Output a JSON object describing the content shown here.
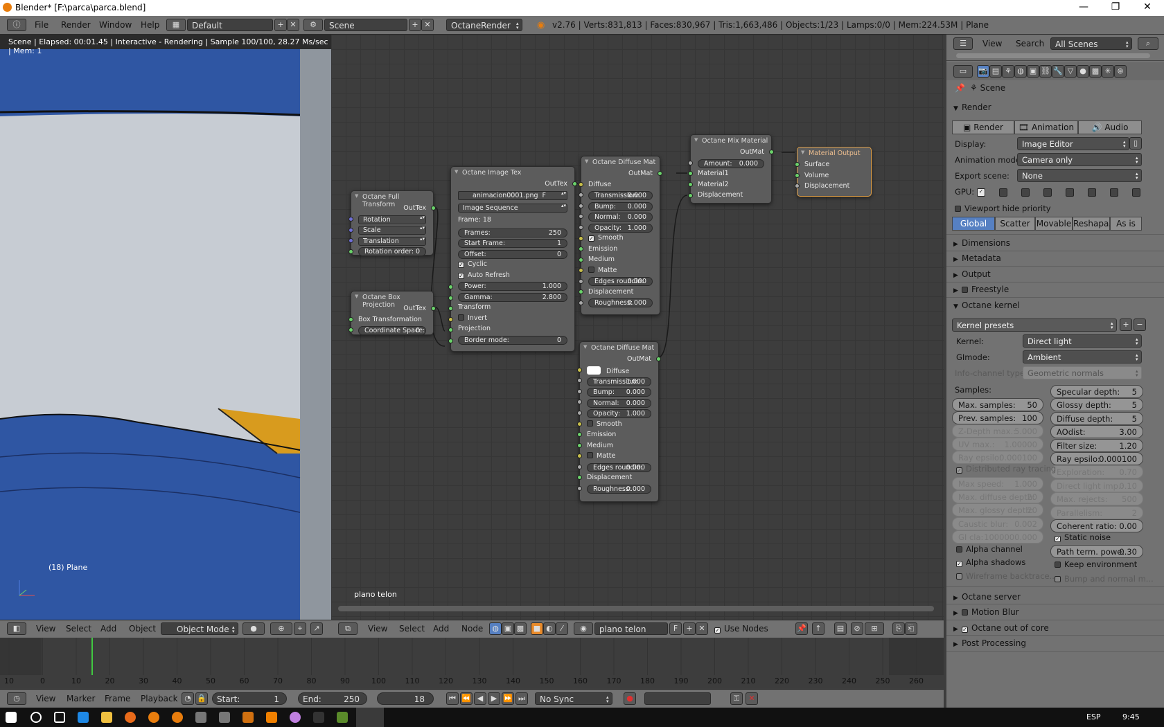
{
  "window": {
    "title": "Blender* [F:\\parca\\parca.blend]",
    "minimize": "—",
    "maximize": "❐",
    "close": "✕"
  },
  "topmenu": {
    "file": "File",
    "render": "Render",
    "window": "Window",
    "help": "Help",
    "layout": "Default",
    "scene": "Scene",
    "engine": "OctaneRender"
  },
  "stats": "v2.76 | Verts:831,813 | Faces:830,967 | Tris:1,663,486 | Objects:1/23 | Lamps:0/0 | Mem:224.53M | Plane",
  "viewport": {
    "status": "Scene | Elapsed: 00:01.45 | Interactive - Rendering | Sample 100/100, 28.27 Ms/sec | Mem: 1",
    "object_label": "(18) Plane",
    "axes": {
      "x": "x",
      "y": "y",
      "z": "z"
    }
  },
  "viewport_header": {
    "view": "View",
    "select": "Select",
    "add": "Add",
    "object": "Object",
    "mode": "Object Mode"
  },
  "nodes": {
    "full_transform": {
      "title": "Octane Full Transform",
      "out": "OutTex",
      "rotation": "Rotation",
      "scale": "Scale",
      "translation": "Translation",
      "rotation_order_label": "Rotation order:",
      "rotation_order": "0"
    },
    "box_projection": {
      "title": "Octane Box Projection",
      "out": "OutTex",
      "box_transform": "Box Transformation",
      "coord_label": "Coordinate Space:",
      "coord": "0"
    },
    "image_tex": {
      "title": "Octane Image Tex",
      "out": "OutTex",
      "file": "animacion0001.png",
      "f": "F",
      "source": "Image Sequence",
      "frame": "Frame: 18",
      "frames_label": "Frames:",
      "frames": "250",
      "start_label": "Start Frame:",
      "start": "1",
      "offset_label": "Offset:",
      "offset": "0",
      "cyclic": "Cyclic",
      "auto_refresh": "Auto Refresh",
      "power_label": "Power:",
      "power": "1.000",
      "gamma_label": "Gamma:",
      "gamma": "2.800",
      "transform": "Transform",
      "invert": "Invert",
      "projection": "Projection",
      "border_label": "Border mode:",
      "border": "0"
    },
    "diffuse1": {
      "title": "Octane Diffuse Mat",
      "out": "OutMat",
      "diffuse": "Diffuse",
      "transmission_label": "Transmission:",
      "transmission": "0.000",
      "bump_label": "Bump:",
      "bump": "0.000",
      "normal_label": "Normal:",
      "normal": "0.000",
      "opacity_label": "Opacity:",
      "opacity": "1.000",
      "smooth": "Smooth",
      "emission": "Emission",
      "medium": "Medium",
      "matte": "Matte",
      "edges_label": "Edges roundin:",
      "edges": "0.000",
      "displacement": "Displacement",
      "roughness_label": "Roughness:",
      "roughness": "0.000"
    },
    "diffuse2": {
      "title": "Octane Diffuse Mat",
      "out": "OutMat",
      "diffuse": "Diffuse",
      "transmission_label": "Transmission:",
      "transmission": "1.000",
      "bump_label": "Bump:",
      "bump": "0.000",
      "normal_label": "Normal:",
      "normal": "0.000",
      "opacity_label": "Opacity:",
      "opacity": "1.000",
      "smooth": "Smooth",
      "emission": "Emission",
      "medium": "Medium",
      "matte": "Matte",
      "edges_label": "Edges roundin:",
      "edges": "0.000",
      "displacement": "Displacement",
      "roughness_label": "Roughness:",
      "roughness": "0.000"
    },
    "mix": {
      "title": "Octane Mix Material",
      "out": "OutMat",
      "amount_label": "Amount:",
      "amount": "0.000",
      "material1": "Material1",
      "material2": "Material2",
      "displacement": "Displacement"
    },
    "output": {
      "title": "Material Output",
      "surface": "Surface",
      "volume": "Volume",
      "displacement": "Displacement"
    }
  },
  "node_editor": {
    "material_label": "plano telon"
  },
  "node_header": {
    "view": "View",
    "select": "Select",
    "add": "Add",
    "node": "Node",
    "material": "plano telon",
    "f": "F",
    "use_nodes": "Use Nodes"
  },
  "timeline": {
    "ticks": [
      "10",
      "0",
      "10",
      "20",
      "30",
      "40",
      "50",
      "60",
      "70",
      "80",
      "90",
      "100",
      "110",
      "120",
      "130",
      "140",
      "150",
      "160",
      "170",
      "180",
      "190",
      "200",
      "210",
      "220",
      "230",
      "240",
      "250",
      "260"
    ],
    "current_frame_fraction": 0.097
  },
  "timeline_header": {
    "view": "View",
    "marker": "Marker",
    "frame": "Frame",
    "playback": "Playback",
    "start_label": "Start:",
    "start": "1",
    "end_label": "End:",
    "end": "250",
    "current": "18",
    "sync": "No Sync"
  },
  "props": {
    "outliner": {
      "view": "View",
      "search": "Search",
      "scenes": "All Scenes"
    },
    "scene": "Scene",
    "render_panel": "Render",
    "render_btn": "Render",
    "animation_btn": "Animation",
    "audio_btn": "Audio",
    "display_label": "Display:",
    "display": "Image Editor",
    "anim_mode_label": "Animation mode:",
    "anim_mode": "Camera only",
    "export_label": "Export scene:",
    "export": "None",
    "gpu_label": "GPU:",
    "viewport_hide": "Viewport hide priority",
    "tabs": [
      "Global",
      "Scatter",
      "Movable",
      "Reshapa...",
      "As is"
    ],
    "dimensions": "Dimensions",
    "metadata": "Metadata",
    "output": "Output",
    "freestyle": "Freestyle",
    "kernel": "Octane kernel",
    "kernel_presets": "Kernel presets",
    "kernel_label": "Kernel:",
    "kernel_val": "Direct light",
    "gimode_label": "GImode:",
    "gimode": "Ambient",
    "infochannel_label": "Info-channel type:",
    "infochannel": "Geometric normals",
    "samples_label": "Samples:",
    "left": [
      {
        "label": "Max. samples:",
        "value": "50",
        "dis": false
      },
      {
        "label": "Prev. samples:",
        "value": "100",
        "dis": false
      },
      {
        "label": "Z-Depth max.:",
        "value": "5.000",
        "dis": true
      },
      {
        "label": "UV max.:",
        "value": "1.00000",
        "dis": true
      },
      {
        "label": "Ray epsilo:",
        "value": "0.000100",
        "dis": true
      }
    ],
    "right": [
      {
        "label": "Specular depth:",
        "value": "5",
        "dis": false
      },
      {
        "label": "Glossy depth:",
        "value": "5",
        "dis": false
      },
      {
        "label": "Diffuse depth:",
        "value": "5",
        "dis": false
      },
      {
        "label": "AOdist:",
        "value": "3.00",
        "dis": false
      },
      {
        "label": "Filter size:",
        "value": "1.20",
        "dis": false
      },
      {
        "label": "Ray epsilo:",
        "value": "0.000100",
        "dis": false
      },
      {
        "label": "Exploration:",
        "value": "0.70",
        "dis": true
      },
      {
        "label": "Direct light imp.:",
        "value": "0.10",
        "dis": true
      },
      {
        "label": "Max. rejects:",
        "value": "500",
        "dis": true
      },
      {
        "label": "Parallelism:",
        "value": "2",
        "dis": true
      },
      {
        "label": "Coherent ratio:",
        "value": "0.00",
        "dis": false
      }
    ],
    "distributed": "Distributed ray tracing",
    "left2": [
      {
        "label": "Max speed:",
        "value": "1.000",
        "dis": true
      },
      {
        "label": "Max. diffuse depth:",
        "value": "20",
        "dis": true
      },
      {
        "label": "Max. glossy depth:",
        "value": "20",
        "dis": true
      },
      {
        "label": "Caustic blur:",
        "value": "0.002",
        "dis": true
      },
      {
        "label": "GI cla:",
        "value": "1000000.000",
        "dis": true
      }
    ],
    "static_noise": "Static noise",
    "alpha_channel": "Alpha channel",
    "path_term_label": "Path term. powe:",
    "path_term": "0.30",
    "alpha_shadows": "Alpha shadows",
    "keep_env": "Keep environment",
    "wireframe": "Wireframe backtrace...",
    "bump_normal": "Bump and normal m...",
    "server": "Octane server",
    "motion_blur": "Motion Blur",
    "out_of_core": "Octane out of core",
    "post": "Post Processing"
  },
  "taskbar": {
    "lang": "ESP",
    "time": "9:45"
  },
  "colors": {
    "accent": "#5680c2",
    "node_bg": "#5c5c5c",
    "socket_green": "#6bd36b",
    "socket_yellow": "#c9c04a",
    "socket_blue": "#7070d8",
    "selected": "#e5a246"
  }
}
